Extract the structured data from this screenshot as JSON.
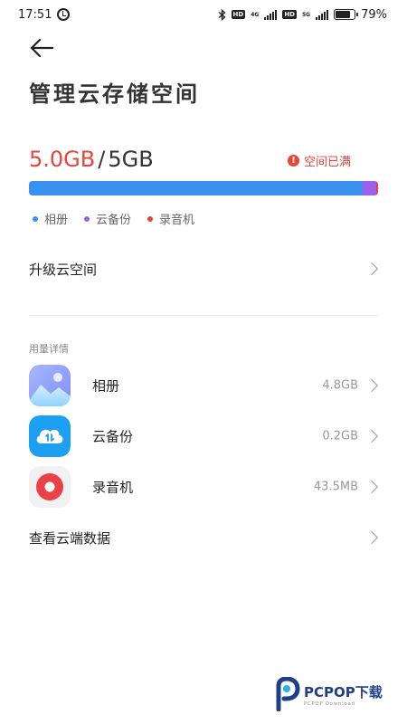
{
  "status_bar": {
    "time": "17:51",
    "hd1": "HD",
    "net1": "4G",
    "hd2": "HD",
    "net2": "5G",
    "battery": "79%",
    "battery_level": 0.79
  },
  "header": {
    "title": "管理云存储空间"
  },
  "usage": {
    "used": "5.0GB",
    "separator": "/",
    "total": "5GB",
    "status": "空间已满",
    "segments": [
      {
        "name": "相册",
        "fraction": 0.955,
        "color": "#3b8ff0"
      },
      {
        "name": "云备份",
        "fraction": 0.04,
        "color": "#9b62e8"
      },
      {
        "name": "录音机",
        "fraction": 0.005,
        "color": "#e5453a"
      }
    ]
  },
  "legend": [
    {
      "label": "相册",
      "color": "#3b8ff0"
    },
    {
      "label": "云备份",
      "color": "#9b62e8"
    },
    {
      "label": "录音机",
      "color": "#e5453a"
    }
  ],
  "upgrade": {
    "label": "升级云空间"
  },
  "details": {
    "section_label": "用量详情",
    "items": [
      {
        "name": "相册",
        "size": "4.8GB",
        "icon": "gallery-icon"
      },
      {
        "name": "云备份",
        "size": "0.2GB",
        "icon": "cloud-backup-icon"
      },
      {
        "name": "录音机",
        "size": "43.5MB",
        "icon": "recorder-icon"
      }
    ]
  },
  "cloud_data": {
    "label": "查看云端数据"
  },
  "watermark": {
    "brand": "PCPOP下载",
    "sub": "PCPOP Download"
  }
}
